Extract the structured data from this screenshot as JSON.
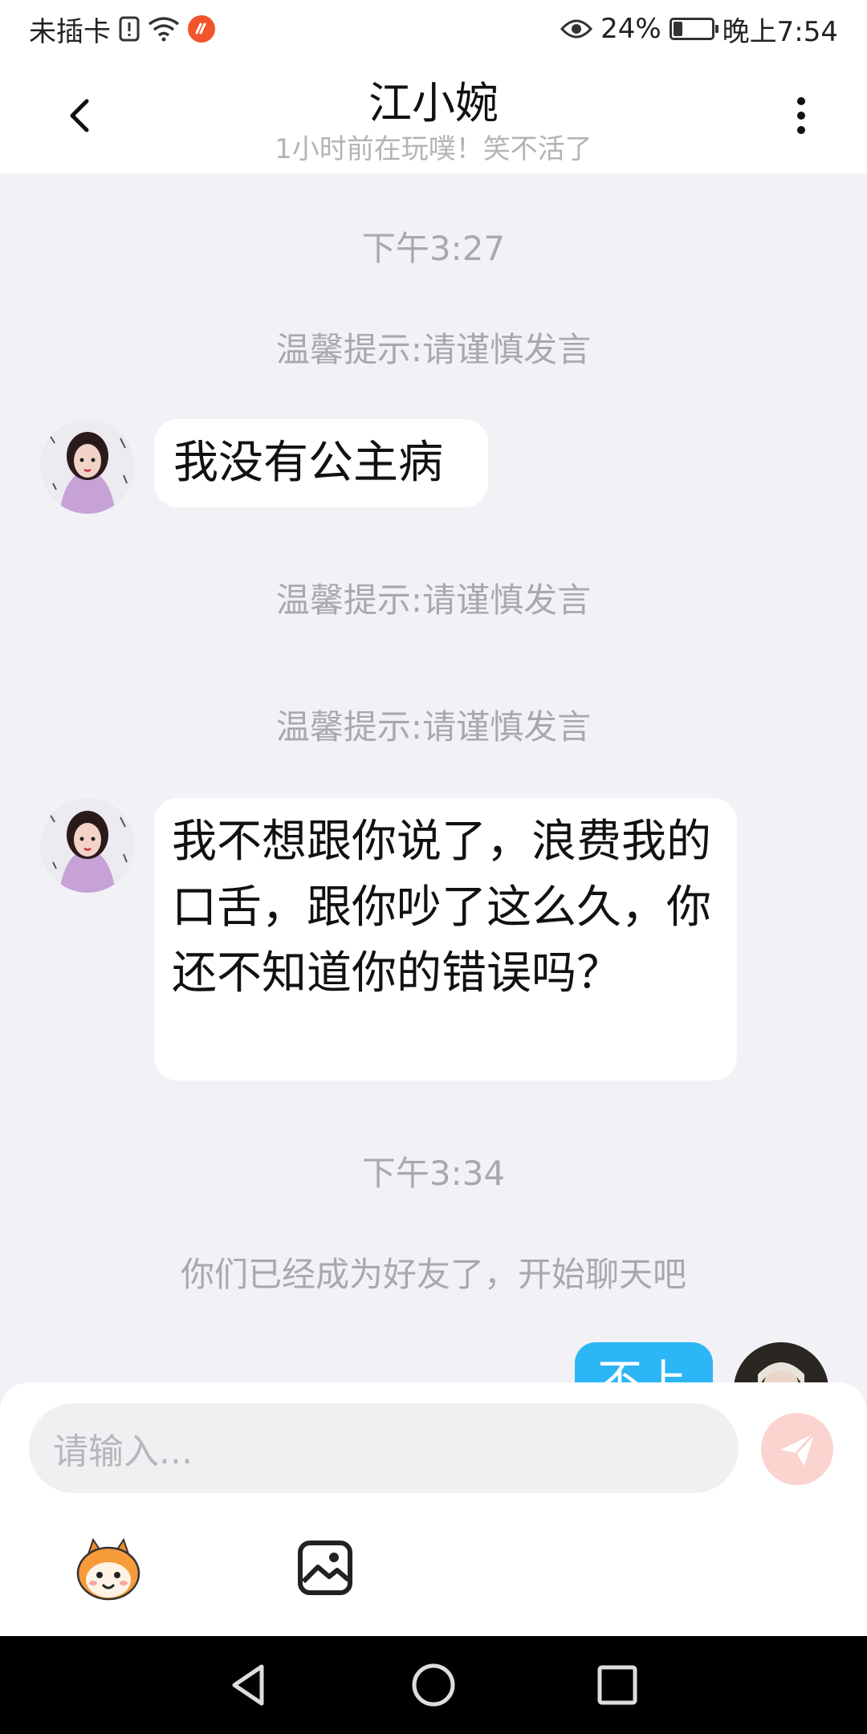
{
  "status_bar": {
    "carrier": "未插卡",
    "battery_percent": "24%",
    "battery_level": 0.24,
    "time": "晚上7:54",
    "icons": [
      "sim-alert-icon",
      "wifi-icon",
      "app-notification-icon",
      "eye-comfort-icon",
      "battery-icon"
    ]
  },
  "header": {
    "title": "江小婉",
    "subtitle": "1小时前在玩噗！笑不活了",
    "back_icon": "chevron-left-icon",
    "more_icon": "more-vertical-icon"
  },
  "messages": {
    "time_1": "下午3:27",
    "tip_1": "温馨提示:请谨慎发言",
    "incoming_1": "我没有公主病",
    "tip_2": "温馨提示:请谨慎发言",
    "tip_3": "温馨提示:请谨慎发言",
    "incoming_2": "我不想跟你说了，浪费我的口舌，跟你吵了这么久，你还不知道你的错误吗？",
    "time_2": "下午3:34",
    "friend_notice": "你们已经成为好友了，开始聊天吧",
    "outgoing_partial": "不上"
  },
  "input": {
    "placeholder": "请输入...",
    "send_icon": "send-icon",
    "tools": [
      "emoji-mascot-icon",
      "image-icon"
    ]
  },
  "colors": {
    "accent": "#2db6f5",
    "send_disabled": "#fbd3cf",
    "background": "#f2f2f6"
  },
  "nav": {
    "icons": [
      "back-triangle-icon",
      "home-circle-icon",
      "recents-square-icon"
    ]
  }
}
